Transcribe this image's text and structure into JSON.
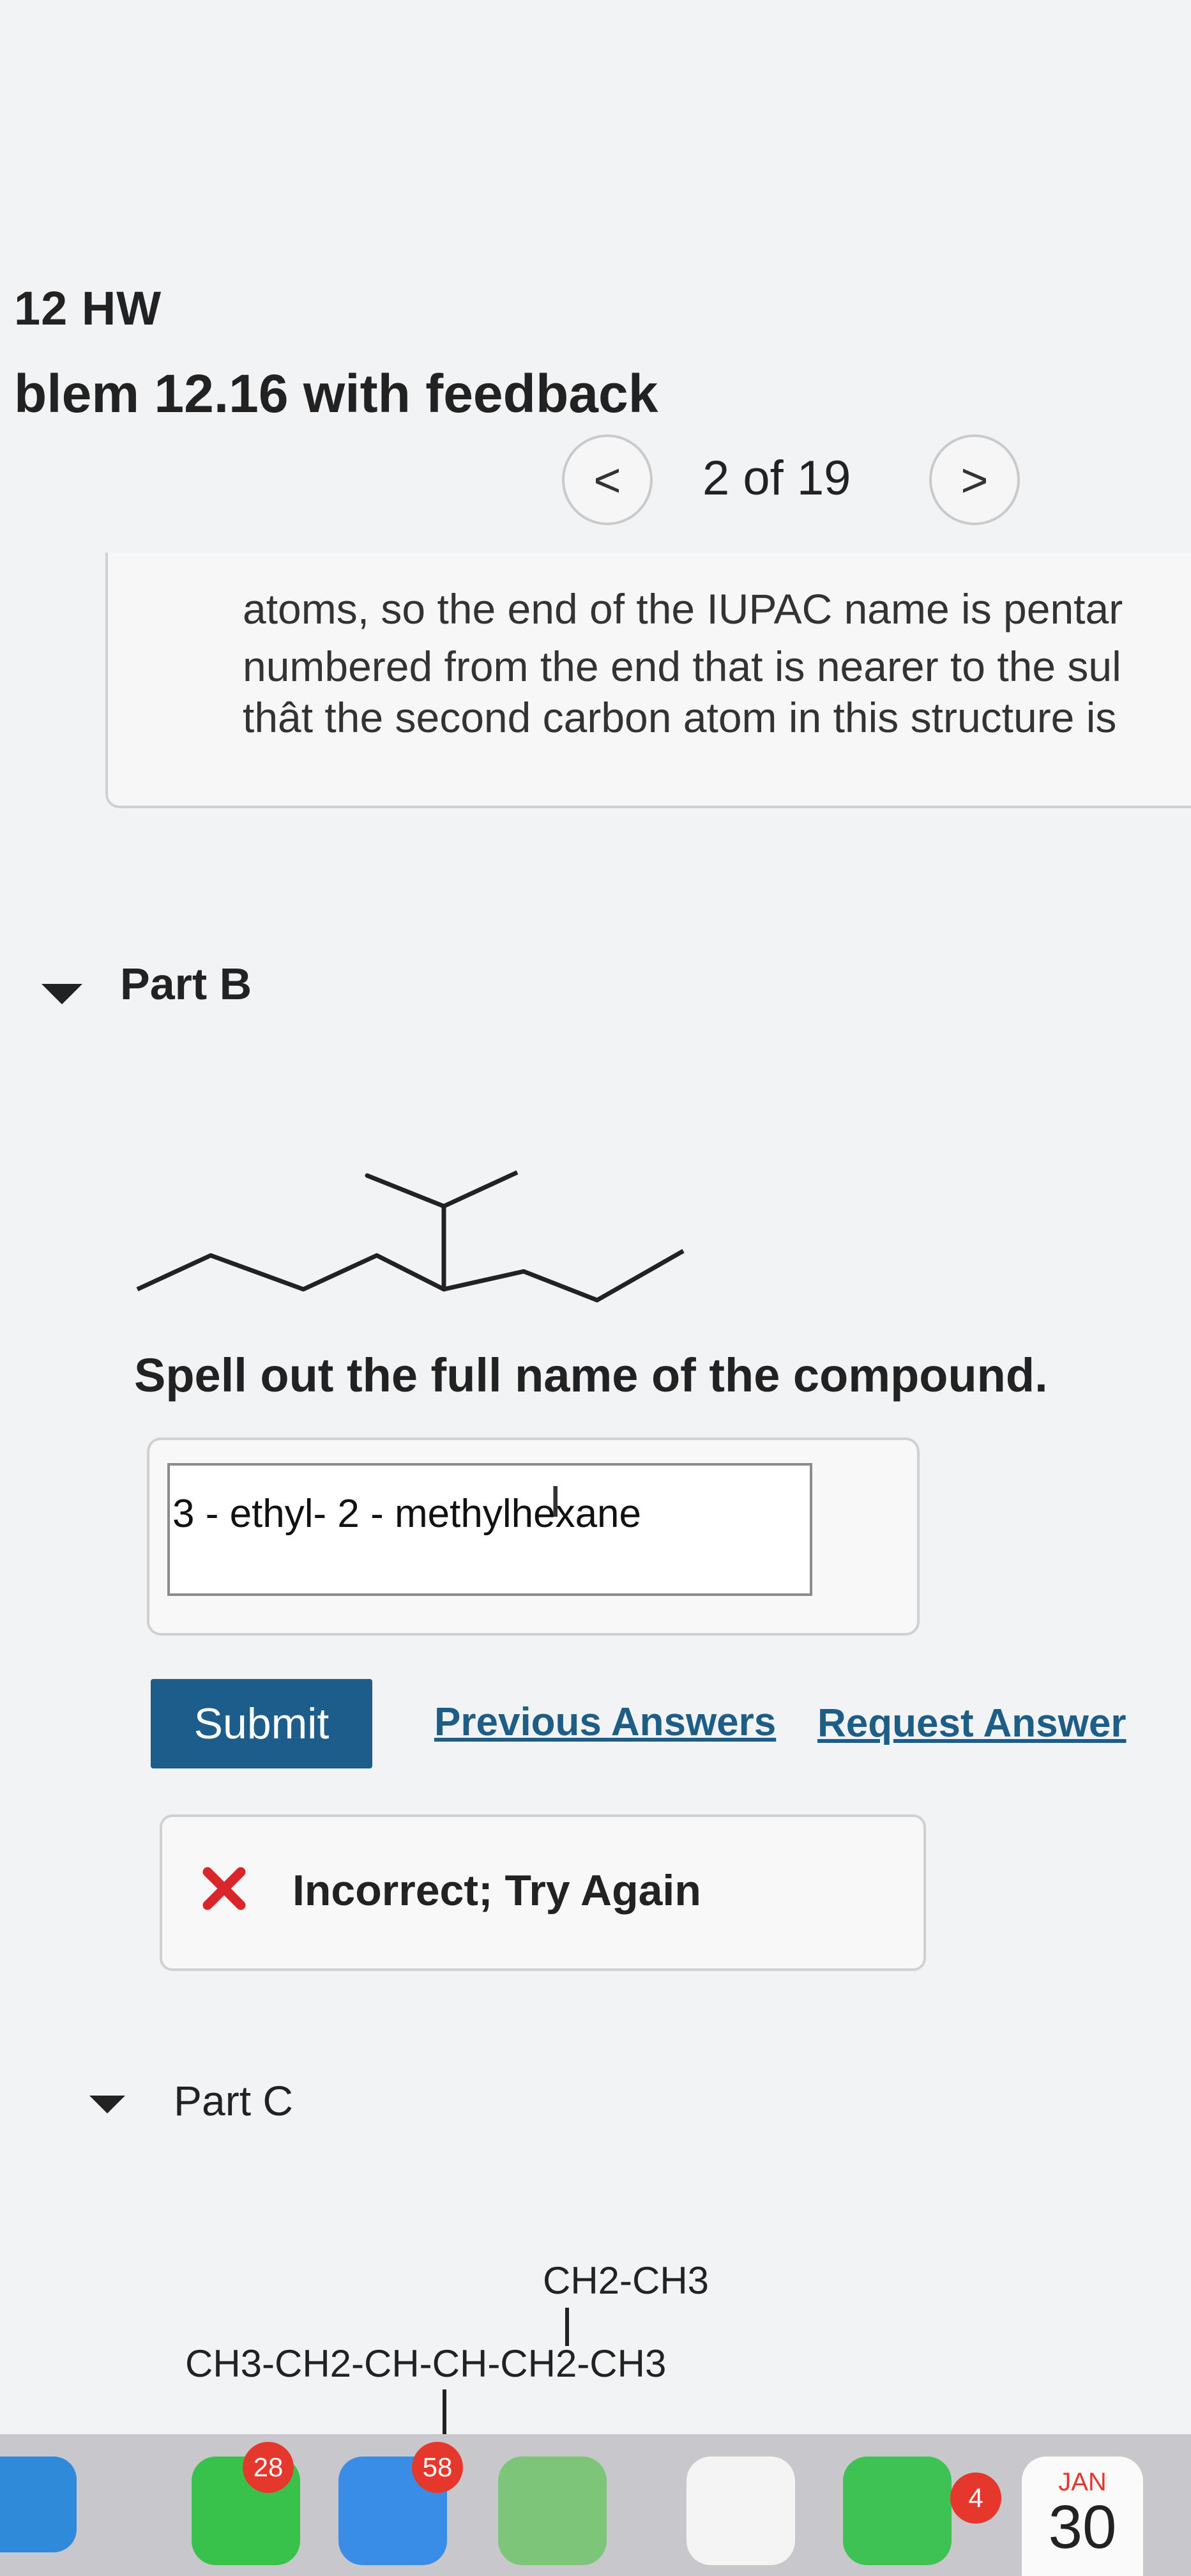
{
  "header": {
    "assignment_title": "12 HW",
    "problem_title": "blem 12.16 with feedback"
  },
  "nav": {
    "prev_label": "<",
    "position": "2 of 19",
    "next_label": ">"
  },
  "feedback_text": [
    "atoms, so the end of the IUPAC name is pentar",
    "numbered from the end that is nearer to the sul",
    "thât the second carbon atom in this structure is"
  ],
  "part_b": {
    "heading": "Part B",
    "question": "Spell out the full name of the compound.",
    "answer_value": "3 - ethyl- 2 - methylhexane",
    "submit_label": "Submit",
    "previous_answers_label": "Previous Answers",
    "request_answer_label": "Request Answer",
    "result_icon": "x-mark-icon",
    "result_text": "Incorrect; Try Again",
    "colors": {
      "submit": "#1c5d8b",
      "links": "#1d5d86",
      "error": "#d9262a"
    }
  },
  "part_c": {
    "heading": "Part C",
    "formula_branch": "CH2-CH3",
    "formula_main": "CH3-CH2-CH-CH-CH2-CH3"
  },
  "dock": {
    "apps": [
      "safari-icon",
      "messages-icon",
      "mail-icon",
      "maps-icon",
      "photos-icon",
      "facetime-icon",
      "calendar-icon"
    ],
    "messages_badge": "28",
    "mail_badge": "58",
    "facetime_badge": "4",
    "calendar_month": "JAN",
    "calendar_day": "30"
  }
}
